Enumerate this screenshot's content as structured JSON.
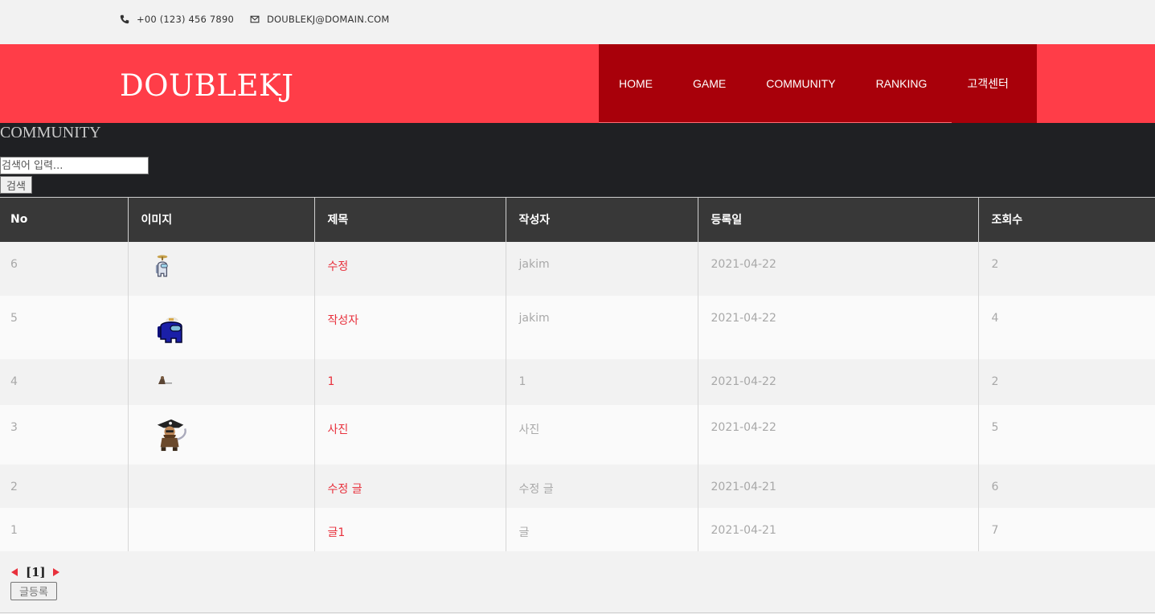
{
  "topbar": {
    "phone": "+00 (123) 456 7890",
    "email": "DOUBLEKJ@DOMAIN.COM"
  },
  "header": {
    "brand": "DOUBLEKJ",
    "nav": [
      "HOME",
      "GAME",
      "COMMUNITY",
      "RANKING",
      "고객센터"
    ]
  },
  "search": {
    "section_title": "COMMUNITY",
    "placeholder": "검색어 입력...",
    "button": "검색"
  },
  "table": {
    "headers": [
      "No",
      "이미지",
      "제목",
      "작성자",
      "등록일",
      "조회수"
    ],
    "rows": [
      {
        "no": "6",
        "image": "crewmate-white-propeller-icon",
        "title": "수정",
        "author": "jakim",
        "date": "2021-04-22",
        "views": "2"
      },
      {
        "no": "5",
        "image": "crewmate-blue-icon",
        "title": "작성자",
        "author": "jakim",
        "date": "2021-04-22",
        "views": "4"
      },
      {
        "no": "4",
        "image": "small-creature-icon",
        "title": "1",
        "author": "1",
        "date": "2021-04-22",
        "views": "2"
      },
      {
        "no": "3",
        "image": "pirate-character-icon",
        "title": "사진",
        "author": "사진",
        "date": "2021-04-22",
        "views": "5"
      },
      {
        "no": "2",
        "image": "",
        "title": "수정 글",
        "author": "수정 글",
        "date": "2021-04-21",
        "views": "6"
      },
      {
        "no": "1",
        "image": "",
        "title": "글1",
        "author": "글",
        "date": "2021-04-21",
        "views": "7"
      }
    ]
  },
  "pager": {
    "current": "[1]"
  },
  "write_button": "글등록",
  "colors": {
    "header_red": "#ff3d48",
    "nav_dark_red": "#a8000a",
    "dark_band": "#1f2023",
    "table_header": "#383838",
    "title_link": "#e8303c"
  }
}
